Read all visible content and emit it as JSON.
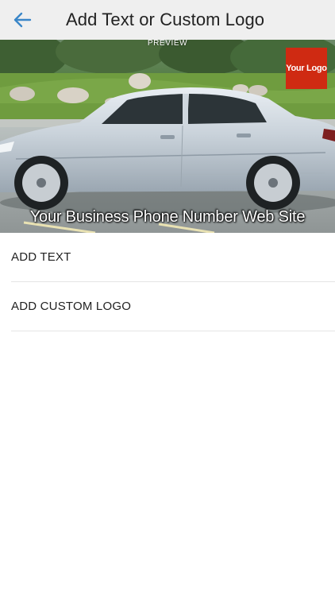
{
  "header": {
    "title": "Add Text or Custom Logo",
    "back_icon": "arrow-left-icon",
    "accent_color": "#3a86c8"
  },
  "preview": {
    "label": "PREVIEW",
    "logo_text": "Your Logo",
    "logo_color": "#cf2a12",
    "caption": "Your Business Phone Number Web Site"
  },
  "menu": {
    "items": [
      {
        "label": "ADD TEXT"
      },
      {
        "label": "ADD CUSTOM LOGO"
      }
    ]
  }
}
